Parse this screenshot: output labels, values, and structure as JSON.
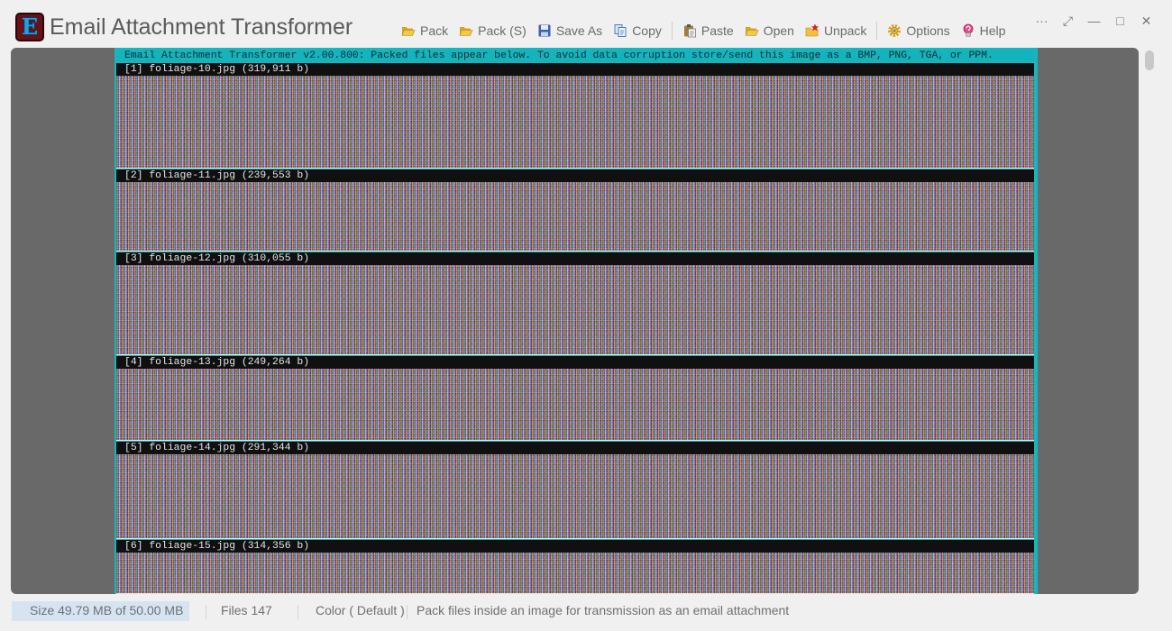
{
  "app": {
    "logo_letter": "E",
    "title": "Email Attachment Transformer"
  },
  "toolbar": {
    "buttons": [
      {
        "label": "Pack",
        "icon": "folder-open-icon"
      },
      {
        "label": "Pack (S)",
        "icon": "folder-open-icon"
      },
      {
        "label": "Save As",
        "icon": "floppy-disk-icon"
      },
      {
        "label": "Copy",
        "icon": "copy-icon"
      },
      {
        "label": "Paste",
        "icon": "clipboard-paste-icon"
      },
      {
        "label": "Open",
        "icon": "folder-open-icon"
      },
      {
        "label": "Unpack",
        "icon": "star-folder-icon"
      },
      {
        "label": "Options",
        "icon": "gear-icon"
      },
      {
        "label": "Help",
        "icon": "help-bulb-icon"
      }
    ]
  },
  "window_controls": {
    "more": "···",
    "fullscreen": "⤢",
    "minimize": "—",
    "maximize": "□",
    "close": "✕"
  },
  "document": {
    "header": "Email Attachment Transformer v2.00.800: Packed files appear below. To avoid data corruption store/send this image as a BMP, PNG, TGA, or PPM.",
    "files": [
      {
        "label": "[1] foliage-10.jpg (319,911 b)"
      },
      {
        "label": "[2] foliage-11.jpg (239,553 b)"
      },
      {
        "label": "[3] foliage-12.jpg (310,055 b)"
      },
      {
        "label": "[4] foliage-13.jpg (249,264 b)"
      },
      {
        "label": "[5] foliage-14.jpg (291,344 b)"
      },
      {
        "label": "[6] foliage-15.jpg (314,356 b)"
      }
    ]
  },
  "status": {
    "size": "Size 49.79 MB of 50.00 MB",
    "files": "Files 147",
    "color": "Color ( Default )",
    "message": "Pack files inside an image for transmission as an email attachment"
  },
  "colors": {
    "viewport_bg": "#696969",
    "document_border": "#18b5bf",
    "label_bg": "#101010",
    "size_highlight": "#d6e4f2"
  }
}
